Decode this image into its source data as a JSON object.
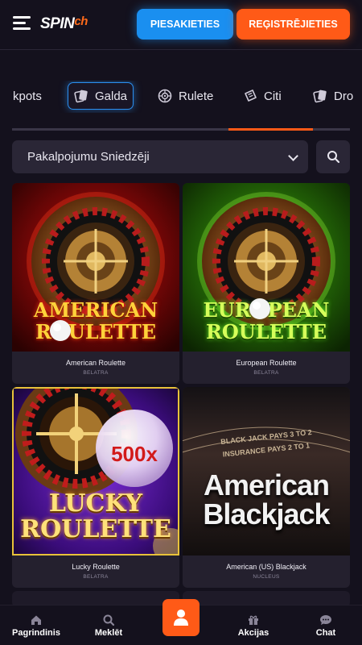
{
  "header": {
    "logo_main": "SPIN",
    "logo_accent": "ch",
    "login_label": "PIESAKIETIES",
    "register_label": "REĢISTRĒJIETIES"
  },
  "tabs": [
    {
      "label": "kpots",
      "icon": "jackpot-icon"
    },
    {
      "label": "Galda",
      "icon": "cards-icon",
      "active": true
    },
    {
      "label": "Rulete",
      "icon": "roulette-icon"
    },
    {
      "label": "Citi",
      "icon": "ticket-icon"
    },
    {
      "label": "Dro",
      "icon": "cards-icon"
    }
  ],
  "scroll_progress": {
    "start": 0.64,
    "end": 0.89
  },
  "filter": {
    "provider_label": "Pakalpojumu Sniedzēji"
  },
  "games": [
    {
      "name": "American Roulette",
      "provider": "BELATRA",
      "thumb_line1": "AMERICAN",
      "thumb_line2": "ROULETTE"
    },
    {
      "name": "European Roulette",
      "provider": "BELATRA",
      "thumb_line1": "EUROPEAN",
      "thumb_line2": "ROULETTE"
    },
    {
      "name": "Lucky Roulette",
      "provider": "BELATRA",
      "thumb_line1": "LUCKY",
      "thumb_line2": "ROULETTE",
      "multiplier": "500x"
    },
    {
      "name": "American (US) Blackjack",
      "provider": "NUCLEUS",
      "thumb_line1": "American",
      "thumb_line2": "Blackjack",
      "felt_line1": "BLACK JACK PAYS 3 TO 2",
      "felt_line2": "INSURANCE PAYS 2 TO 1"
    }
  ],
  "bottom_nav": {
    "home": "Pagrindinis",
    "search": "Meklēt",
    "promotions": "Akcijas",
    "chat": "Chat"
  },
  "colors": {
    "background": "#14111d",
    "accent_orange": "#ff5a17",
    "accent_blue": "#1a8ff0",
    "card_bg": "#24202e"
  }
}
